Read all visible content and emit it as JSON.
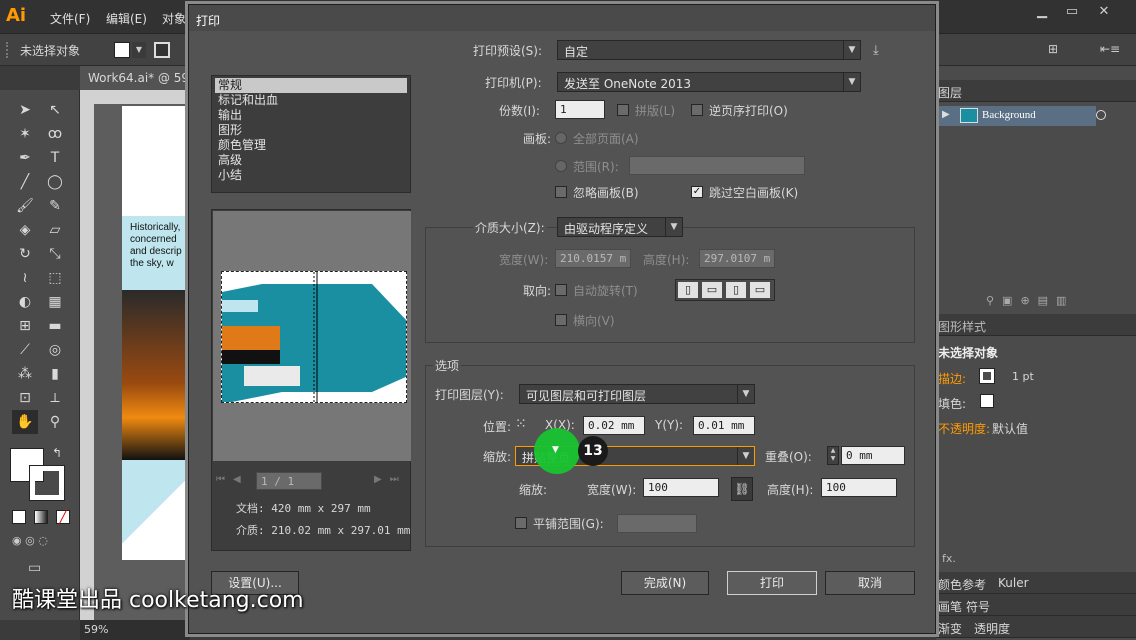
{
  "app": {
    "logo": "Ai",
    "menu": [
      "文件(F)",
      "编辑(E)",
      "对象"
    ],
    "control_bar_label": "未选择对象",
    "doc_tab": "Work64.ai* @ 59",
    "zoom": "59%"
  },
  "canvas_text": [
    "Historically,",
    "concerned",
    "and descrip",
    "the  sky,  w"
  ],
  "right_panel": {
    "layers_tab": "图层",
    "layer_name": "Background",
    "graphic_styles_tab": "图形样式",
    "appearance_title": "未选择对象",
    "stroke_label": "描边:",
    "stroke_value": "1 pt",
    "fill_label": "填色:",
    "opacity_label": "不透明度:",
    "opacity_value": "默认值",
    "bottom_tabs_1": [
      "颜色参考",
      "Kuler"
    ],
    "bottom_tabs_2": [
      "画笔",
      "符号"
    ],
    "bottom_tabs_3": [
      "渐变",
      "透明度"
    ]
  },
  "dialog": {
    "title": "打印",
    "categories": [
      "常规",
      "标记和出血",
      "输出",
      "图形",
      "颜色管理",
      "高级",
      "小结"
    ],
    "selected_category": 0,
    "preset_label": "打印预设(S):",
    "preset_value": "自定",
    "printer_label": "打印机(P):",
    "printer_value": "发送至 OneNote 2013",
    "copies_label": "份数(I):",
    "copies_value": "1",
    "collate_label": "拼版(L)",
    "reverse_label": "逆页序打印(O)",
    "artboard_label": "画板:",
    "all_pages_label": "全部页面(A)",
    "range_label": "范围(R):",
    "ignore_artboards_label": "忽略画板(B)",
    "skip_blank_label": "跳过空白画板(K)",
    "media_size_label": "介质大小(Z):",
    "media_size_value": "由驱动程序定义",
    "width_label": "宽度(W):",
    "width_value": "210.0157 m",
    "height_label": "高度(H):",
    "height_value": "297.0107 m",
    "orientation_label": "取向:",
    "auto_rotate_label": "自动旋转(T)",
    "transverse_label": "横向(V)",
    "options_title": "选项",
    "print_layers_label": "打印图层(Y):",
    "print_layers_value": "可见图层和可打印图层",
    "position_label": "位置:",
    "x_label": "X(X):",
    "x_value": "0.02 mm",
    "y_label": "Y(Y):",
    "y_value": "0.01 mm",
    "scaling_label": "缩放:",
    "scaling_value": "拼贴整页",
    "overlap_label": "重叠(O):",
    "overlap_value": "0 mm",
    "scale_label": "缩放:",
    "scale_width_label": "宽度(W):",
    "scale_width_value": "100",
    "scale_height_label": "高度(H):",
    "scale_height_value": "100",
    "tile_range_label": "平铺范围(G):",
    "page_nav": "1 / 1",
    "doc_size": "文档: 420 mm x 297 mm",
    "media_info": "介质: 210.02 mm x 297.01 mm",
    "setup_button": "设置(U)...",
    "done_button": "完成(N)",
    "print_button": "打印",
    "cancel_button": "取消"
  },
  "overlay": {
    "step_number": "13",
    "watermark": "酷课堂出品 coolketang.com"
  },
  "colors": {
    "accent_orange": "#ff9a00",
    "highlight_green": "#19c431",
    "teal": "#1a8fa2"
  }
}
